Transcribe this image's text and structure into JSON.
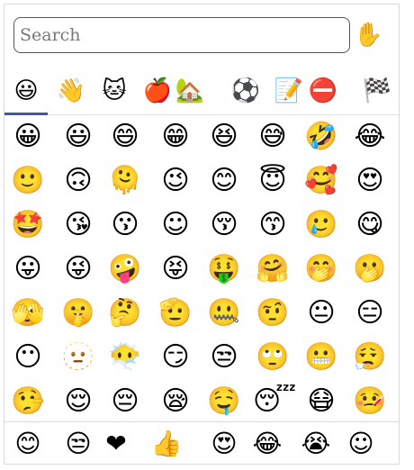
{
  "search": {
    "placeholder": "Search"
  },
  "skin_tone": {
    "icon": "✋"
  },
  "categories": [
    {
      "name": "smileys",
      "icon": "😃"
    },
    {
      "name": "people",
      "icon": "👋"
    },
    {
      "name": "animals",
      "icon": "🐱"
    },
    {
      "name": "food",
      "icon": "🍎"
    },
    {
      "name": "travel",
      "icon": "🏡"
    },
    {
      "name": "activities",
      "icon": "⚽"
    },
    {
      "name": "objects",
      "icon": "📝"
    },
    {
      "name": "symbols",
      "icon": "⛔"
    },
    {
      "name": "flags",
      "icon": "🏁"
    }
  ],
  "grid_rows": [
    [
      "😀",
      "😃",
      "😄",
      "😁",
      "😆",
      "😅",
      "🤣",
      "😂"
    ],
    [
      "🙂",
      "🙃",
      "🫠",
      "😉",
      "😊",
      "😇",
      "🥰",
      "😍"
    ],
    [
      "🤩",
      "😘",
      "😗",
      "☺",
      "😚",
      "😙",
      "🥲",
      "😋"
    ],
    [
      "😛",
      "😜",
      "🤪",
      "😝",
      "🤑",
      "🤗",
      "🤭",
      "🫢"
    ],
    [
      "🫣",
      "🤫",
      "🤔",
      "🫡",
      "🤐",
      "🤨",
      "😐",
      "😑"
    ],
    [
      "😶",
      "🫥",
      "😶‍🌫️",
      "😏",
      "😒",
      "🙄",
      "😬",
      "😮‍💨"
    ],
    [
      "🤥",
      "😌",
      "😔",
      "😪",
      "🤤",
      "😴",
      "😷",
      "🤒"
    ]
  ],
  "recent": [
    "😊",
    "😒",
    "❤",
    "👍",
    "😍",
    "😂",
    "😭",
    "☺"
  ]
}
